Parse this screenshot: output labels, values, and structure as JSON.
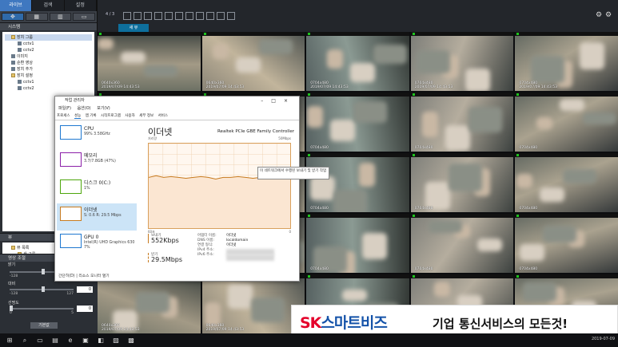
{
  "left_panel": {
    "tabs": [
      "라이브",
      "검색",
      "설정"
    ],
    "system_header": "시스템",
    "tree": [
      {
        "label": "장치 그룹",
        "level": 1,
        "kind": "group",
        "selected": true
      },
      {
        "label": "cctv1",
        "level": 2,
        "kind": "cam"
      },
      {
        "label": "cctv2",
        "level": 2,
        "kind": "cam"
      },
      {
        "label": "이미지",
        "level": 1,
        "kind": "cam"
      },
      {
        "label": "순환 영상",
        "level": 1,
        "kind": "cam"
      },
      {
        "label": "장치 추가",
        "level": 1,
        "kind": "cam"
      },
      {
        "label": "장치 설정",
        "level": 1,
        "kind": "group"
      },
      {
        "label": "cctv1",
        "level": 2,
        "kind": "cam"
      },
      {
        "label": "cctv2",
        "level": 2,
        "kind": "cam"
      }
    ],
    "view_header": "뷰",
    "view_tree": [
      {
        "label": "뷰 목록",
        "level": 1,
        "kind": "group"
      },
      {
        "label": "새 그룹",
        "level": 2,
        "kind": "group"
      },
      {
        "label": "새 뷰",
        "level": 3,
        "kind": "cam",
        "selected": true
      }
    ],
    "video_adjust": {
      "header": "영상 조절",
      "brightness": {
        "label": "밝기",
        "min": "-128",
        "max": "127",
        "value": "0"
      },
      "contrast": {
        "label": "대비",
        "min": "-128",
        "max": "127",
        "value": "0"
      },
      "sharpness": {
        "label": "선명도",
        "min": "0",
        "max": "5",
        "value": "0"
      },
      "default_button": "기본값"
    }
  },
  "toolbar": {
    "page_indicator": "4 / 3",
    "subtab": "새 뷰"
  },
  "cameras": [
    {
      "label": "0640x360\n2019/07/09 14:43:53"
    },
    {
      "label": "0640x360\n2019/07/09 14:43:53"
    },
    {
      "label": "0704x480\n2019/07/09 14:43:53"
    },
    {
      "label": "0704x480\n2019/07/09 14:43:53"
    },
    {
      "label": "0704x480\n2019/07/09 14:43:53"
    },
    {
      "label": ""
    },
    {
      "label": ""
    },
    {
      "label": "0704x480"
    },
    {
      "label": "0704x480"
    },
    {
      "label": "0704x480"
    },
    {
      "label": ""
    },
    {
      "label": ""
    },
    {
      "label": "0704x480"
    },
    {
      "label": "0704x480"
    },
    {
      "label": "0704x480"
    },
    {
      "label": ""
    },
    {
      "label": ""
    },
    {
      "label": "0704x480"
    },
    {
      "label": "0704x480"
    },
    {
      "label": "0704x480"
    },
    {
      "label": "0640x360\n2019/07/09 14:43:53"
    },
    {
      "label": "0640x360\n2019/07/09 14:43:53"
    },
    {
      "label": ""
    },
    {
      "label": ""
    },
    {
      "label": ""
    }
  ],
  "task_manager": {
    "title": "작업 관리자",
    "menu": [
      "파일(F)",
      "옵션(O)",
      "보기(V)"
    ],
    "tabs": [
      "프로세스",
      "성능",
      "앱 기록",
      "시작프로그램",
      "사용자",
      "세부 정보",
      "서비스"
    ],
    "resources": [
      {
        "name": "CPU",
        "sub": "99% 3.58GHz",
        "color": "#1e78d0"
      },
      {
        "name": "메모리",
        "sub": "3.7/7.8GB (47%)",
        "color": "#8b1fa8"
      },
      {
        "name": "디스크 0(C:)",
        "sub": "1%",
        "color": "#4da60c"
      },
      {
        "name": "이더넷",
        "sub": "S: 0.6 R: 29.5 Mbps",
        "color": "#c77a1e",
        "selected": true
      },
      {
        "name": "GPU 0",
        "sub": "Intel(R) UHD Graphics 630\n7%",
        "color": "#1e78d0"
      }
    ],
    "main_title": "이더넷",
    "adapter": "Realtek PCIe GBE Family Controller",
    "graph_label": "처리량",
    "graph_max": "50Mbps",
    "graph_left": "60초",
    "graph_right": "0",
    "tooltip": "이 네트워크에서 수행된 보내기 및 받기 작업",
    "send_label": "보내기",
    "send_value": "552Kbps",
    "recv_label": "받기",
    "recv_value": "29.5Mbps",
    "info_labels": [
      "어댑터 이름:",
      "DNS 이름:",
      "연결 형식:",
      "IPv4 주소:",
      "IPv6 주소:"
    ],
    "info_values": [
      "이더넷",
      "localdomain",
      "이더넷",
      "",
      ""
    ],
    "footer": "간단히(D)   |   리소스 모니터 열기"
  },
  "banner": {
    "brand_sk": "SK",
    "brand_rest": "스마트비즈",
    "tagline": "기업 통신서비스의 모든것!"
  },
  "taskbar": {
    "clock": "2019-07-09"
  },
  "throughput_series": [
    0.6,
    0.62,
    0.6,
    0.61,
    0.6,
    0.59,
    0.6,
    0.61,
    0.6,
    0.58,
    0.6,
    0.6,
    0.61,
    0.6,
    0.59,
    0.6,
    0.61,
    0.6,
    0.6,
    0.59
  ]
}
